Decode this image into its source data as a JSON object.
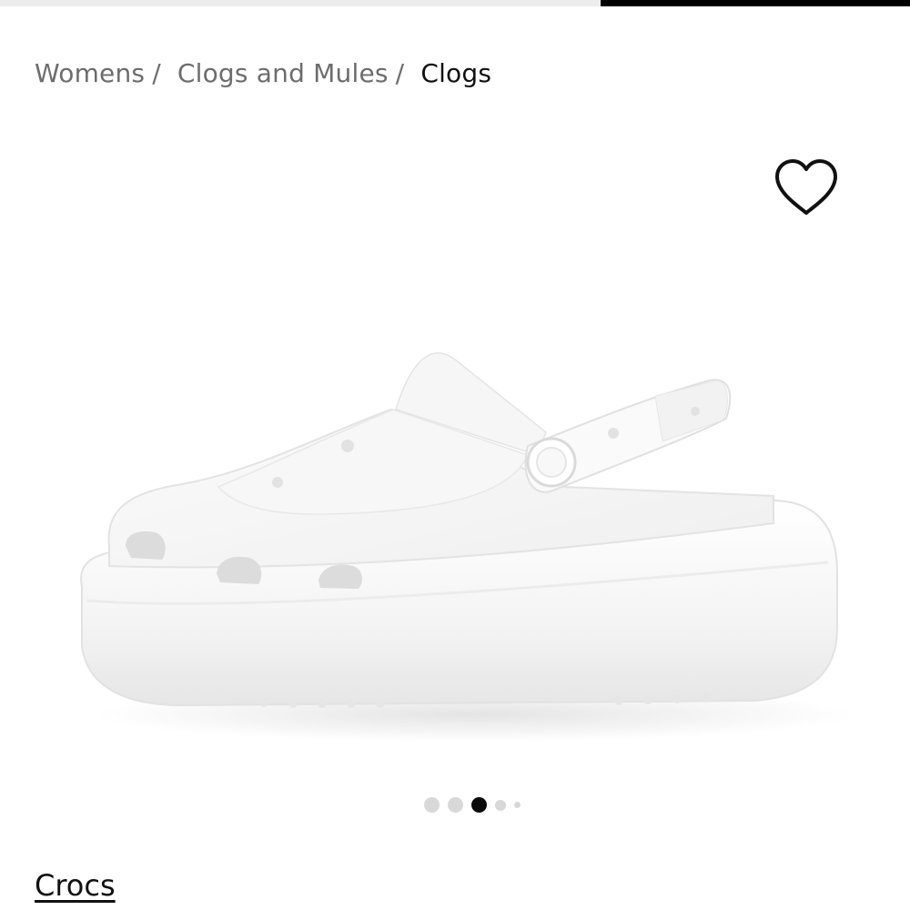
{
  "top_bar": {
    "progress_fraction": 0.34,
    "fill_color": "#000000",
    "track_color": "#ececec"
  },
  "breadcrumb": {
    "items": [
      {
        "label": "Womens",
        "separator": "/"
      },
      {
        "label": "Clogs and Mules",
        "separator": "/"
      },
      {
        "label": "Clogs"
      }
    ]
  },
  "wishlist": {
    "icon": "heart-outline-icon"
  },
  "product": {
    "image_icon": "white-platform-clog-image",
    "gallery": {
      "total_images": 5,
      "active_index": 3,
      "active_color": "#0a0a0a",
      "inactive_color": "#d8d8d8"
    },
    "brand": "Crocs"
  }
}
